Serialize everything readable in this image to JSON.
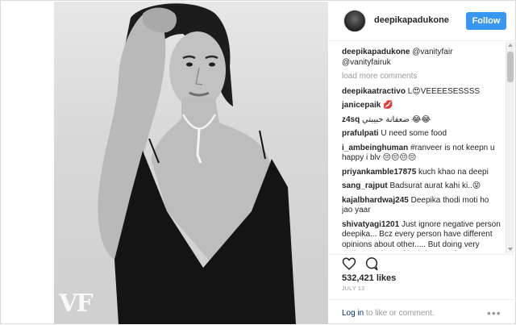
{
  "post": {
    "username": "deepikapadukone",
    "follow_label": "Follow",
    "photo_logo": "VF",
    "caption_user": "deepikapadukone",
    "caption_text": " @vanityfair @vanityfairuk",
    "load_more": "load more comments",
    "comments": [
      {
        "user": "deepikaatractivo",
        "text": " L😍VEEEESESSSS"
      },
      {
        "user": "janicepaik",
        "text": " 💋"
      },
      {
        "user": "z4sq",
        "text": " ضعفانة حبيبتي 😂😂"
      },
      {
        "user": "prafulpati",
        "text": " U need some food"
      },
      {
        "user": "i_ambeinghuman",
        "text": " #ranveer is not keepn u happy i blv 😔😔😔😔"
      },
      {
        "user": "priyankamble17875",
        "text": " kuch khao na deepi"
      },
      {
        "user": "sang_rajput",
        "text": " Badsurat aurat kahi ki..😝"
      },
      {
        "user": "kajalbhardwaj245",
        "text": " Deepika thodi moti ho jao yaar"
      },
      {
        "user": "shivatyagi1201",
        "text": " Just ignore negative person deepika... Bcz every person have different opinions about other..... But doing very well..... So best of luck for your future"
      }
    ],
    "likes": "532,421 likes",
    "date": "JULY 13",
    "login_link": "Log in",
    "login_rest": " to like or comment.",
    "more_label": "•••",
    "icons": [
      "heart-icon",
      "comment-icon",
      "more-options-icon"
    ]
  }
}
